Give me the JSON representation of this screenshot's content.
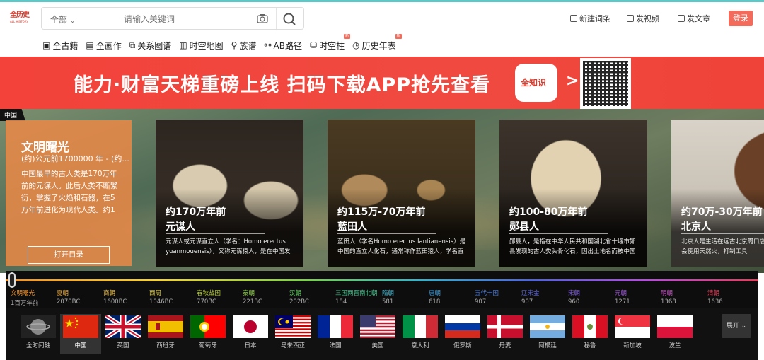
{
  "header": {
    "logo_text": "全历史",
    "logo_sub": "ALL HISTORY",
    "search_category": "全部",
    "search_placeholder": "请输入关键词",
    "actions": [
      {
        "label": "新建词条",
        "icon": "edit-icon"
      },
      {
        "label": "发视频",
        "icon": "video-icon"
      },
      {
        "label": "发文章",
        "icon": "article-icon"
      }
    ],
    "login_label": "登录"
  },
  "nav": [
    {
      "label": "全古籍",
      "icon": "book-icon",
      "new": false
    },
    {
      "label": "全画作",
      "icon": "painting-icon",
      "new": false
    },
    {
      "label": "关系图谱",
      "icon": "graph-icon",
      "new": false
    },
    {
      "label": "时空地图",
      "icon": "map-icon",
      "new": false
    },
    {
      "label": "族谱",
      "icon": "person-icon",
      "new": false
    },
    {
      "label": "AB路径",
      "icon": "path-icon",
      "new": false
    },
    {
      "label": "时空柱",
      "icon": "database-icon",
      "new": true
    },
    {
      "label": "历史年表",
      "icon": "clock-icon",
      "new": true
    }
  ],
  "nav_new_badge": "新",
  "banner": {
    "slogan": "能力·财富天梯重磅上线 扫码下载APP抢先查看",
    "app_logo_text": "全知识",
    "arrow": ">"
  },
  "hero": {
    "region": "中国",
    "era": {
      "title": "文明曙光",
      "date": "(约)公元前1700000 年 - (约...",
      "desc": "中国最早的古人类是170万年前的元谋人。此后人类不断繁衍，掌握了火焰和石器，在5万年前进化为现代人类。约1",
      "button": "打开目录"
    },
    "cards": [
      {
        "time": "约170万年前",
        "name": "元谋人",
        "desc": "元谋人或元谋直立人（学名：Homo erectus yuanmouensis），又称元谋猿人，是在中国发"
      },
      {
        "time": "约115万-70万年前",
        "name": "蓝田人",
        "desc": "蓝田人（学名Homo erectus lantianensis）是中国的直立人化石，通常称作蓝田猿人，学名直"
      },
      {
        "time": "约100-80万年前",
        "name": "郧县人",
        "desc": "郧县人，是指在中华人民共和国湖北省十堰市郧县发现的古人类头骨化石，因出土地名而被中国"
      },
      {
        "time": "约70万-30万年前",
        "name": "北京人",
        "desc": "北京人是生活在远古北京周口店一带的直立人，会使用天然火，打制工具"
      }
    ]
  },
  "timeline": [
    {
      "name": "文明曙光",
      "year": "1百万年前",
      "color": "#f0902a"
    },
    {
      "name": "夏朝",
      "year": "2070BC",
      "color": "#e8a93a"
    },
    {
      "name": "商朝",
      "year": "1600BC",
      "color": "#e6b83a"
    },
    {
      "name": "西周",
      "year": "1046BC",
      "color": "#d9c43a"
    },
    {
      "name": "春秋战国",
      "year": "770BC",
      "color": "#b8cc3a"
    },
    {
      "name": "秦朝",
      "year": "221BC",
      "color": "#8ccf46"
    },
    {
      "name": "汉朝",
      "year": "202BC",
      "color": "#5ccf5a"
    },
    {
      "name": "三国两晋南北朝",
      "year": "184",
      "color": "#3fc08a"
    },
    {
      "name": "隋朝",
      "year": "581",
      "color": "#3ab0c8"
    },
    {
      "name": "唐朝",
      "year": "618",
      "color": "#3a9ad9"
    },
    {
      "name": "五代十国",
      "year": "907",
      "color": "#4a7ad9"
    },
    {
      "name": "辽宋金",
      "year": "907",
      "color": "#5a63d9"
    },
    {
      "name": "宋朝",
      "year": "960",
      "color": "#7a58d9"
    },
    {
      "name": "元朝",
      "year": "1271",
      "color": "#9a50d9"
    },
    {
      "name": "明朝",
      "year": "1368",
      "color": "#c24fc0"
    },
    {
      "name": "清朝",
      "year": "1636",
      "color": "#e0405a"
    }
  ],
  "flags": [
    {
      "label": "全时间轴",
      "icon": "globe-icon"
    },
    {
      "label": "中国",
      "icon": "flag-china-icon",
      "selected": true
    },
    {
      "label": "英国",
      "icon": "flag-uk-icon"
    },
    {
      "label": "西班牙",
      "icon": "flag-spain-icon"
    },
    {
      "label": "葡萄牙",
      "icon": "flag-portugal-icon"
    },
    {
      "label": "日本",
      "icon": "flag-japan-icon"
    },
    {
      "label": "马来西亚",
      "icon": "flag-malaysia-icon"
    },
    {
      "label": "法国",
      "icon": "flag-france-icon"
    },
    {
      "label": "美国",
      "icon": "flag-usa-icon"
    },
    {
      "label": "意大利",
      "icon": "flag-italy-icon"
    },
    {
      "label": "俄罗斯",
      "icon": "flag-russia-icon"
    },
    {
      "label": "丹麦",
      "icon": "flag-denmark-icon"
    },
    {
      "label": "阿根廷",
      "icon": "flag-argentina-icon"
    },
    {
      "label": "秘鲁",
      "icon": "flag-peru-icon"
    },
    {
      "label": "新加坡",
      "icon": "flag-singapore-icon"
    },
    {
      "label": "波兰",
      "icon": "flag-poland-icon"
    }
  ],
  "expand_label": "展开",
  "colors": {
    "accent": "#f26b5b",
    "banner": "#f2423a",
    "era_card": "#e88948"
  }
}
